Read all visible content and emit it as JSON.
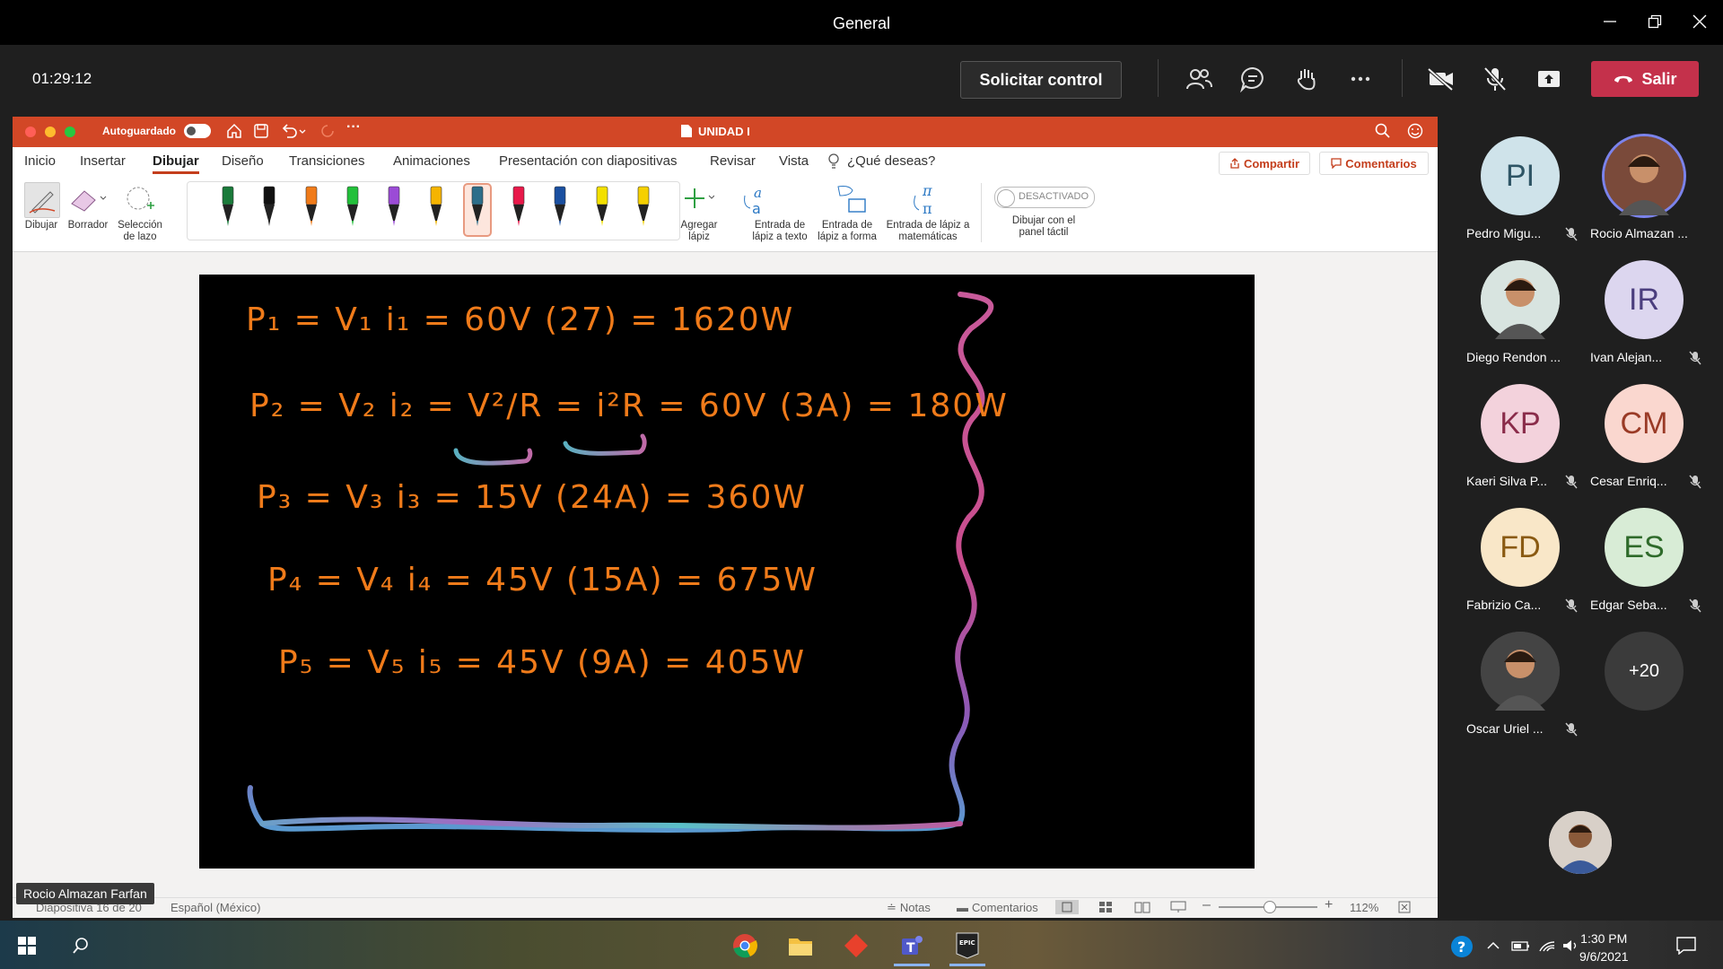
{
  "window": {
    "title": "General"
  },
  "meeting": {
    "timer": "01:29:12",
    "request_control": "Solicitar control",
    "leave": "Salir",
    "leave_color": "#c4314b"
  },
  "powerpoint": {
    "autosave": "Autoguardado",
    "autosave_state": "off",
    "doc_title": "UNIDAD I",
    "accent": "#d24726",
    "tabs": [
      "Inicio",
      "Insertar",
      "Dibujar",
      "Diseño",
      "Transiciones",
      "Animaciones",
      "Presentación con diapositivas",
      "Revisar",
      "Vista"
    ],
    "active_tab": "Dibujar",
    "tell_me": "¿Qué deseas?",
    "share": "Compartir",
    "comments": "Comentarios",
    "tools": {
      "draw": "Dibujar",
      "eraser": "Borrador",
      "lasso": "Selección de lazo"
    },
    "pen_colors": [
      "#1a7a3a",
      "#111111",
      "#f07b1a",
      "#22c03a",
      "#9b4bd6",
      "#f5b400",
      "#2d6e8a",
      "#e8194a",
      "#1a4fa0",
      "#f3e000",
      "#f5d000"
    ],
    "add_pen": "Agregar lápiz",
    "ink_text": "Entrada de lápiz a texto",
    "ink_shape": "Entrada de lápiz a forma",
    "ink_math": "Entrada de lápiz a matemáticas",
    "touch_toggle": "DESACTIVADO",
    "touch_label": "Dibujar con el panel táctil",
    "slide_lines": [
      "P₁ = V₁ i₁ = 60V (27) = 1620W",
      "P₂ = V₂ i₂ = V²/R = i²R = 60V (3A) = 180W",
      "P₃ = V₃ i₃ = 15V (24A) = 360W",
      "P₄ = V₄ i₄ = 45V (15A) = 675W",
      "P₅ = V₅ i₅ = 45V (9A) = 405W"
    ],
    "status": {
      "slide": "Diapositiva 16 de 20",
      "language": "Español (México)",
      "notes": "Notas",
      "comments": "Comentarios",
      "zoom": "112%"
    }
  },
  "presenter": "Rocio Almazan Farfan",
  "participants": [
    {
      "initials": "PI",
      "name": "Pedro Migu...",
      "bg": "#cfe3ea",
      "fg": "#2e5565",
      "muted": true
    },
    {
      "initials": "",
      "name": "Rocio Almazan ...",
      "bg": "#7a4a3a",
      "fg": "#fff",
      "muted": false
    },
    {
      "initials": "",
      "name": "Diego Rendon ...",
      "bg": "#d8e4e0",
      "fg": "#333",
      "muted": false
    },
    {
      "initials": "IR",
      "name": "Ivan Alejan...",
      "bg": "#dcd6ef",
      "fg": "#4b3e7e",
      "muted": true
    },
    {
      "initials": "KP",
      "name": "Kaeri Silva P...",
      "bg": "#f3d2dc",
      "fg": "#8a2c4a",
      "muted": true
    },
    {
      "initials": "CM",
      "name": "Cesar Enriq...",
      "bg": "#fad7cf",
      "fg": "#9a3a26",
      "muted": true
    },
    {
      "initials": "FD",
      "name": "Fabrizio Ca...",
      "bg": "#f9e7c8",
      "fg": "#8a5a12",
      "muted": true
    },
    {
      "initials": "ES",
      "name": "Edgar Seba...",
      "bg": "#d8ecd6",
      "fg": "#2e6a2a",
      "muted": true
    },
    {
      "initials": "",
      "name": "Oscar Uriel ...",
      "bg": "#444",
      "fg": "#fff",
      "muted": true
    },
    {
      "initials": "+20",
      "name": "",
      "bg": "#3b3b3b",
      "fg": "#fff",
      "muted": false
    }
  ],
  "taskbar": {
    "time": "1:30 PM",
    "date": "9/6/2021"
  }
}
